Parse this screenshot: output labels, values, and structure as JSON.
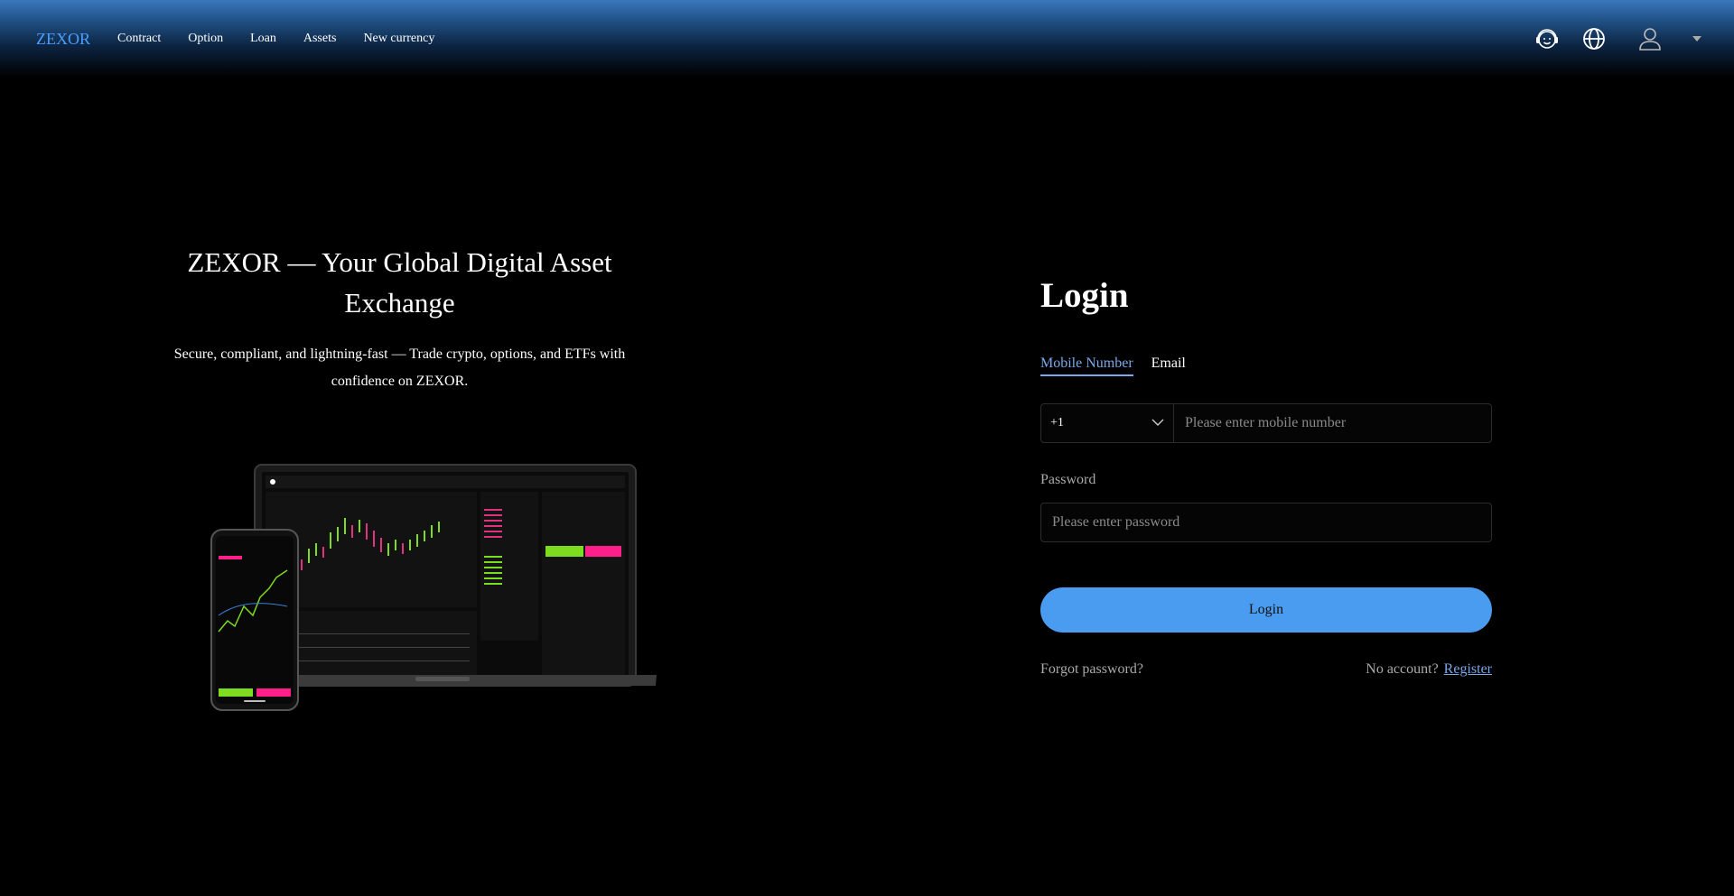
{
  "header": {
    "brand": "ZEXOR",
    "nav": [
      "Contract",
      "Option",
      "Loan",
      "Assets",
      "New currency"
    ]
  },
  "hero": {
    "title": "ZEXOR — Your Global Digital Asset Exchange",
    "subtitle": "Secure, compliant, and lightning-fast — Trade crypto, options, and ETFs with confidence on ZEXOR."
  },
  "login": {
    "title": "Login",
    "tabs": [
      "Mobile Number",
      "Email"
    ],
    "country_code": "+1",
    "mobile_placeholder": "Please enter mobile number",
    "password_label": "Password",
    "password_placeholder": "Please enter password",
    "submit_label": "Login",
    "forgot_label": "Forgot password?",
    "no_account_label": "No account?",
    "register_label": "Register"
  },
  "colors": {
    "accent": "#4a9cf0",
    "link": "#7aa8e8",
    "brand": "#4a9eff"
  }
}
